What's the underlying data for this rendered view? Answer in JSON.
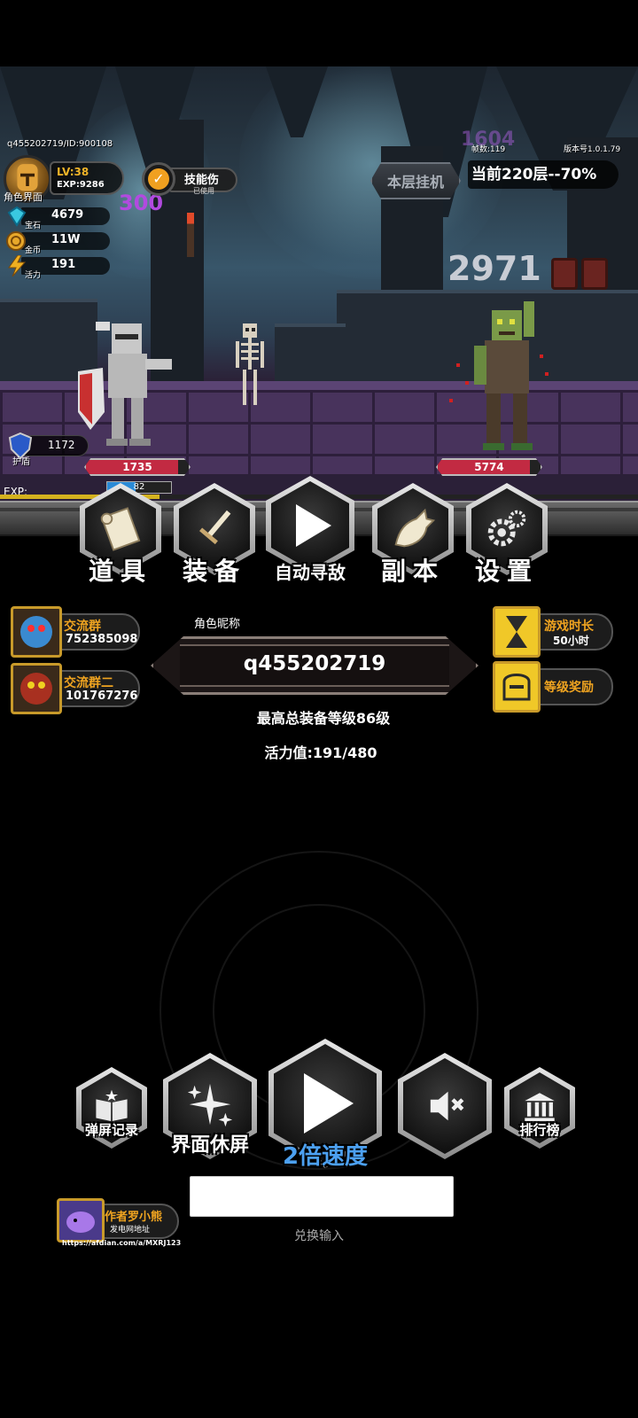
{
  "hud": {
    "player_id_line": "q455202719/ID:900108",
    "fps_label": "帧数:119",
    "version_label": "版本号1.0.1.79",
    "role_screen_label": "角色界面",
    "level_prefix": "LV:",
    "level": "38",
    "exp_label": "EXP:9286",
    "gem_value": "4679",
    "gem_label": "宝石",
    "gold_value": "11W",
    "gold_label": "金币",
    "energy_value": "191",
    "energy_label": "活力",
    "skill_damage_label": "技能伤",
    "skill_used_label": "已使用",
    "hang_button_label": "本层挂机",
    "floor_info": "当前220层--70%",
    "ghost_number_1": "300",
    "ghost_number_2": "2971",
    "ghost_number_3": "1604",
    "shield_value": "1172",
    "shield_label": "护盾",
    "player_hp": "1735",
    "player_mp": "82",
    "enemy_hp": "5774",
    "exp_bar_label": "EXP:",
    "exp_progress": 0.25,
    "player_hp_fraction": 0.9,
    "player_mp_fraction": 0.45,
    "enemy_hp_fraction": 0.9
  },
  "menu": {
    "items": [
      {
        "label": "道具"
      },
      {
        "label": "装备"
      },
      {
        "label": "自动寻敌"
      },
      {
        "label": "副本"
      },
      {
        "label": "设置"
      }
    ]
  },
  "groups": [
    {
      "name": "交流群",
      "number": "752385098"
    },
    {
      "name": "交流群二",
      "number": "101767276"
    }
  ],
  "right_buttons": [
    {
      "name": "游戏时长",
      "sub": "50小时"
    },
    {
      "name": "等级奖励",
      "sub": ""
    }
  ],
  "profile": {
    "nickname_label": "角色昵称",
    "nickname": "q455202719",
    "max_equip": "最高总装备等级86级",
    "vitality": "活力值:191/480"
  },
  "bottom": {
    "danmaku_label": "弹屏记录",
    "sleep_label": "界面休屏",
    "speed_label": "2倍速度",
    "rank_label": "排行榜"
  },
  "author": {
    "name": "作者罗小熊",
    "sub": "发电网地址",
    "url": "https://afdian.com/a/MXRJ123"
  },
  "redeem": {
    "value": "",
    "label": "兑换输入"
  },
  "colors": {
    "accent_gold": "#f0a420",
    "hp_red": "#c22a42",
    "mp_blue": "#2a8ad6",
    "speed_blue": "#4ca0f0"
  }
}
